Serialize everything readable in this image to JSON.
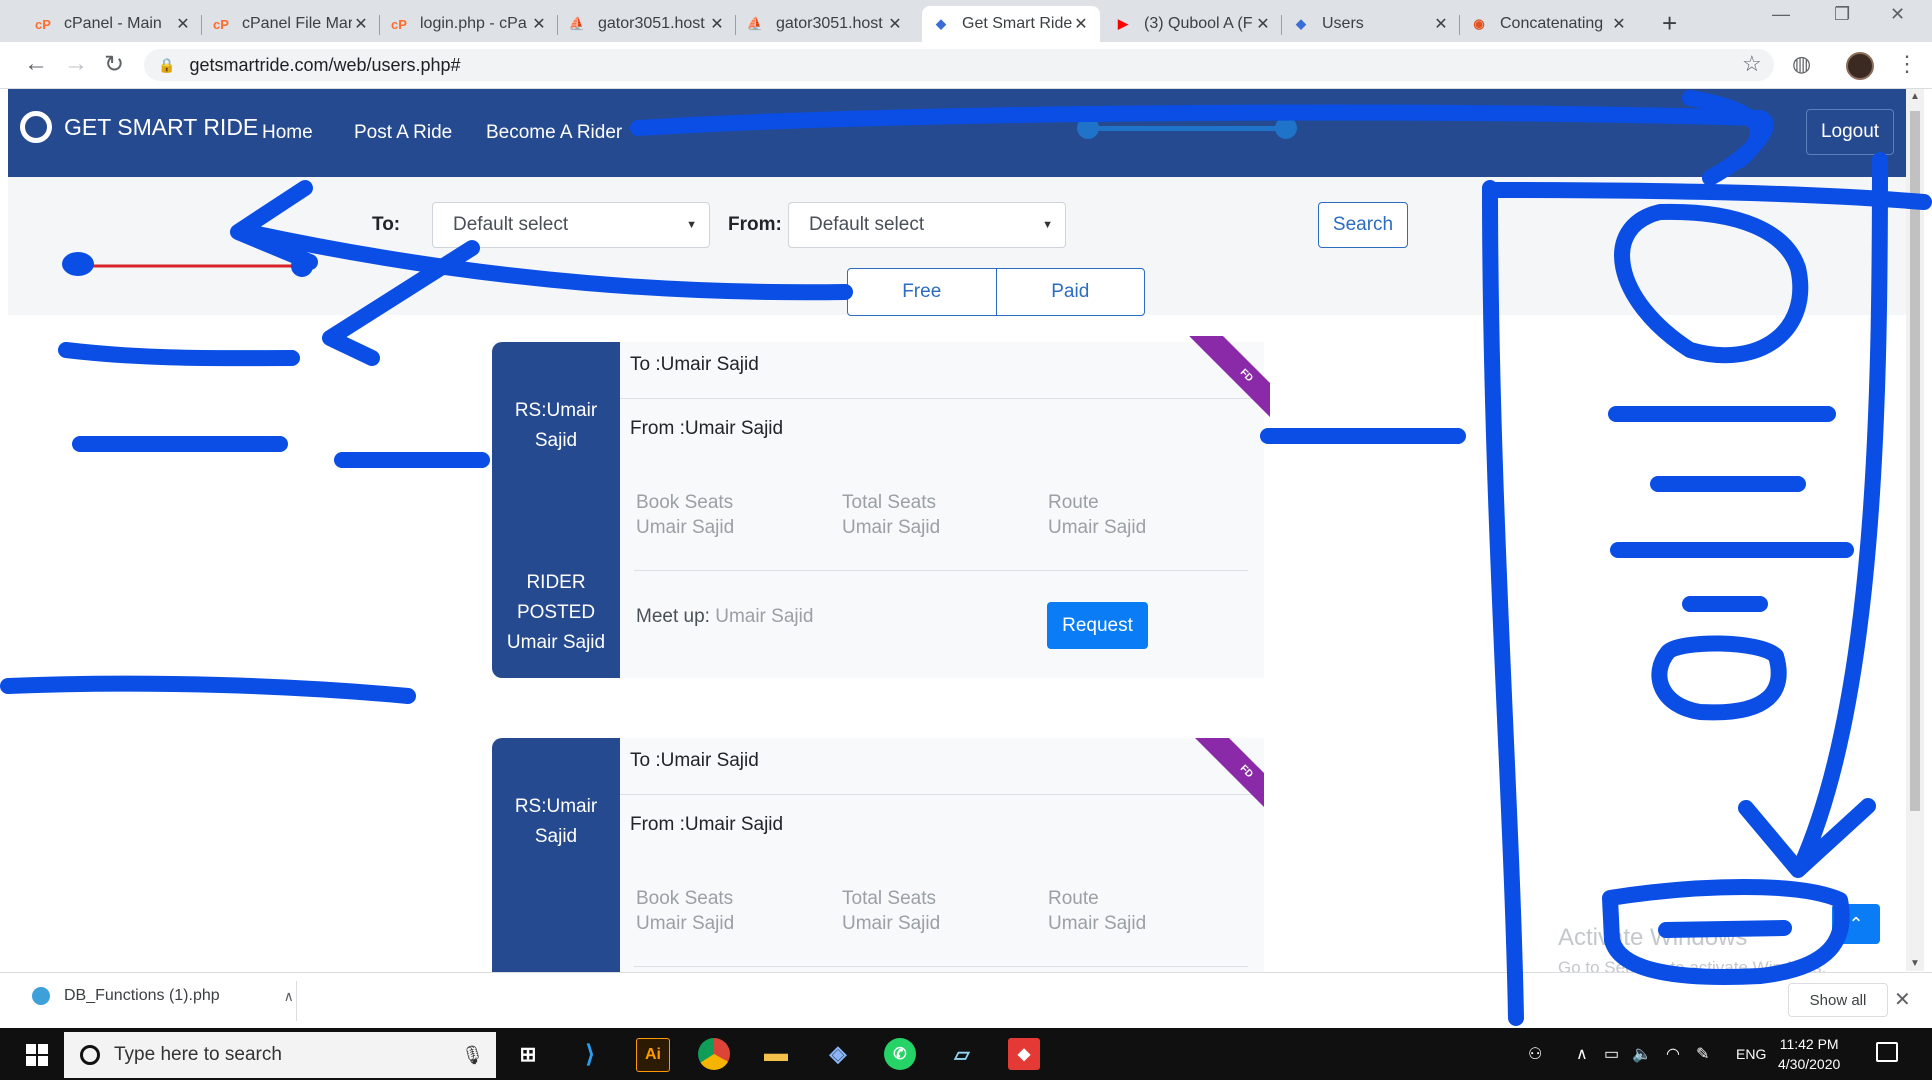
{
  "browser": {
    "tabs": [
      {
        "title": "cPanel - Main",
        "favicon": "cpanel-icon"
      },
      {
        "title": "cPanel File Mar",
        "favicon": "cpanel-icon"
      },
      {
        "title": "login.php - cPa",
        "favicon": "cpanel-icon"
      },
      {
        "title": "gator3051.host",
        "favicon": "phpmyadmin-icon"
      },
      {
        "title": "gator3051.host",
        "favicon": "phpmyadmin-icon"
      },
      {
        "title": "Get Smart Ride",
        "favicon": "site-icon",
        "active": true
      },
      {
        "title": "(3) Qubool A (F",
        "favicon": "youtube-icon"
      },
      {
        "title": "Users",
        "favicon": "site-icon"
      },
      {
        "title": "Concatenating",
        "favicon": "docs-icon"
      }
    ],
    "url": "getsmartride.com/web/users.php#",
    "new_tab": "+",
    "window_controls": {
      "minimize": "—",
      "maximize": "❐",
      "close": "✕"
    }
  },
  "navbar": {
    "brand": "GET SMART RIDE",
    "links": [
      "Home",
      "Post A Ride",
      "Become A Rider"
    ],
    "logout": "Logout"
  },
  "filter": {
    "to_label": "To:",
    "to_value": "Default select",
    "from_label": "From:",
    "from_value": "Default select",
    "range": {
      "min": 0,
      "max": 1
    },
    "search": "Search",
    "segments": [
      "Free",
      "Paid"
    ]
  },
  "cards": [
    {
      "rs": "RS:Umair Sajid",
      "to": "To :Umair Sajid",
      "from": "From :Umair Sajid",
      "book_seats_label": "Book Seats",
      "book_seats_value": "Umair Sajid",
      "total_seats_label": "Total Seats",
      "total_seats_value": "Umair Sajid",
      "route_label": "Route",
      "route_value": "Umair Sajid",
      "posted_label": "RIDER POSTED",
      "posted_by": "Umair Sajid",
      "meet_label": "Meet up:",
      "meet_value": "Umair Sajid",
      "request": "Request",
      "ribbon": "FD"
    },
    {
      "rs": "RS:Umair Sajid",
      "to": "To :Umair Sajid",
      "from": "From :Umair Sajid",
      "book_seats_label": "Book Seats",
      "book_seats_value": "Umair Sajid",
      "total_seats_label": "Total Seats",
      "total_seats_value": "Umair Sajid",
      "route_label": "Route",
      "route_value": "Umair Sajid",
      "ribbon": "FD"
    }
  ],
  "watermark": {
    "line1": "Activate Windows",
    "line2": "Go to Settings to activate Windows."
  },
  "downloads": {
    "file": "DB_Functions (1).php",
    "show_all": "Show all"
  },
  "taskbar": {
    "search_placeholder": "Type here to search",
    "apps": [
      "task-view-icon",
      "vscode-icon",
      "illustrator-icon",
      "chrome-icon",
      "file-explorer-icon",
      "virtualbox-icon",
      "whatsapp-icon",
      "notepad-icon",
      "git-icon"
    ],
    "illustrator_label": "Ai",
    "language": "ENG",
    "time": "11:42 PM",
    "date": "4/30/2020"
  },
  "colors": {
    "navbar": "#264a8f",
    "accent": "#2c6cc1",
    "request": "#0a7cf5",
    "ribbon": "#8a2aa8",
    "annotation": "#0a4ee6",
    "annotation_red": "#d9232a"
  }
}
